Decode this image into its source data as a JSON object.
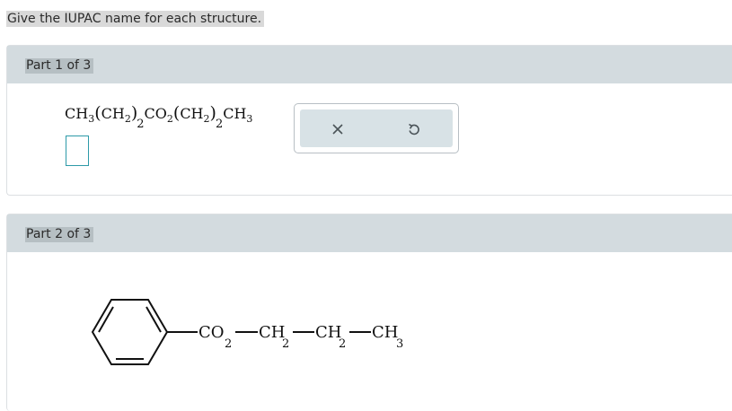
{
  "instruction": "Give the IUPAC name for each structure.",
  "parts": [
    {
      "label": "Part 1 of 3",
      "formula": {
        "g1": "CH",
        "g1_sub": "3",
        "g2": "CH",
        "g2_sub": "2",
        "rep1": "2",
        "g3": "CO",
        "g3_sub": "2",
        "g4": "CH",
        "g4_sub": "2",
        "rep2": "2",
        "g5": "CH",
        "g5_sub": "3"
      },
      "answer_value": "",
      "tools": {
        "clear_icon": "x-icon",
        "undo_icon": "undo-icon"
      }
    },
    {
      "label": "Part 2 of 3",
      "chain": {
        "co": "CO",
        "co_sub": "2",
        "ch2a": "CH",
        "ch2a_sub": "2",
        "ch2b": "CH",
        "ch2b_sub": "2",
        "ch3": "CH",
        "ch3_sub": "3"
      }
    }
  ],
  "colors": {
    "header_bg": "#d3dbdf",
    "label_bg": "#b6bfc3",
    "answer_border": "#2d9aa8",
    "tool_bg": "#d8e2e6"
  }
}
